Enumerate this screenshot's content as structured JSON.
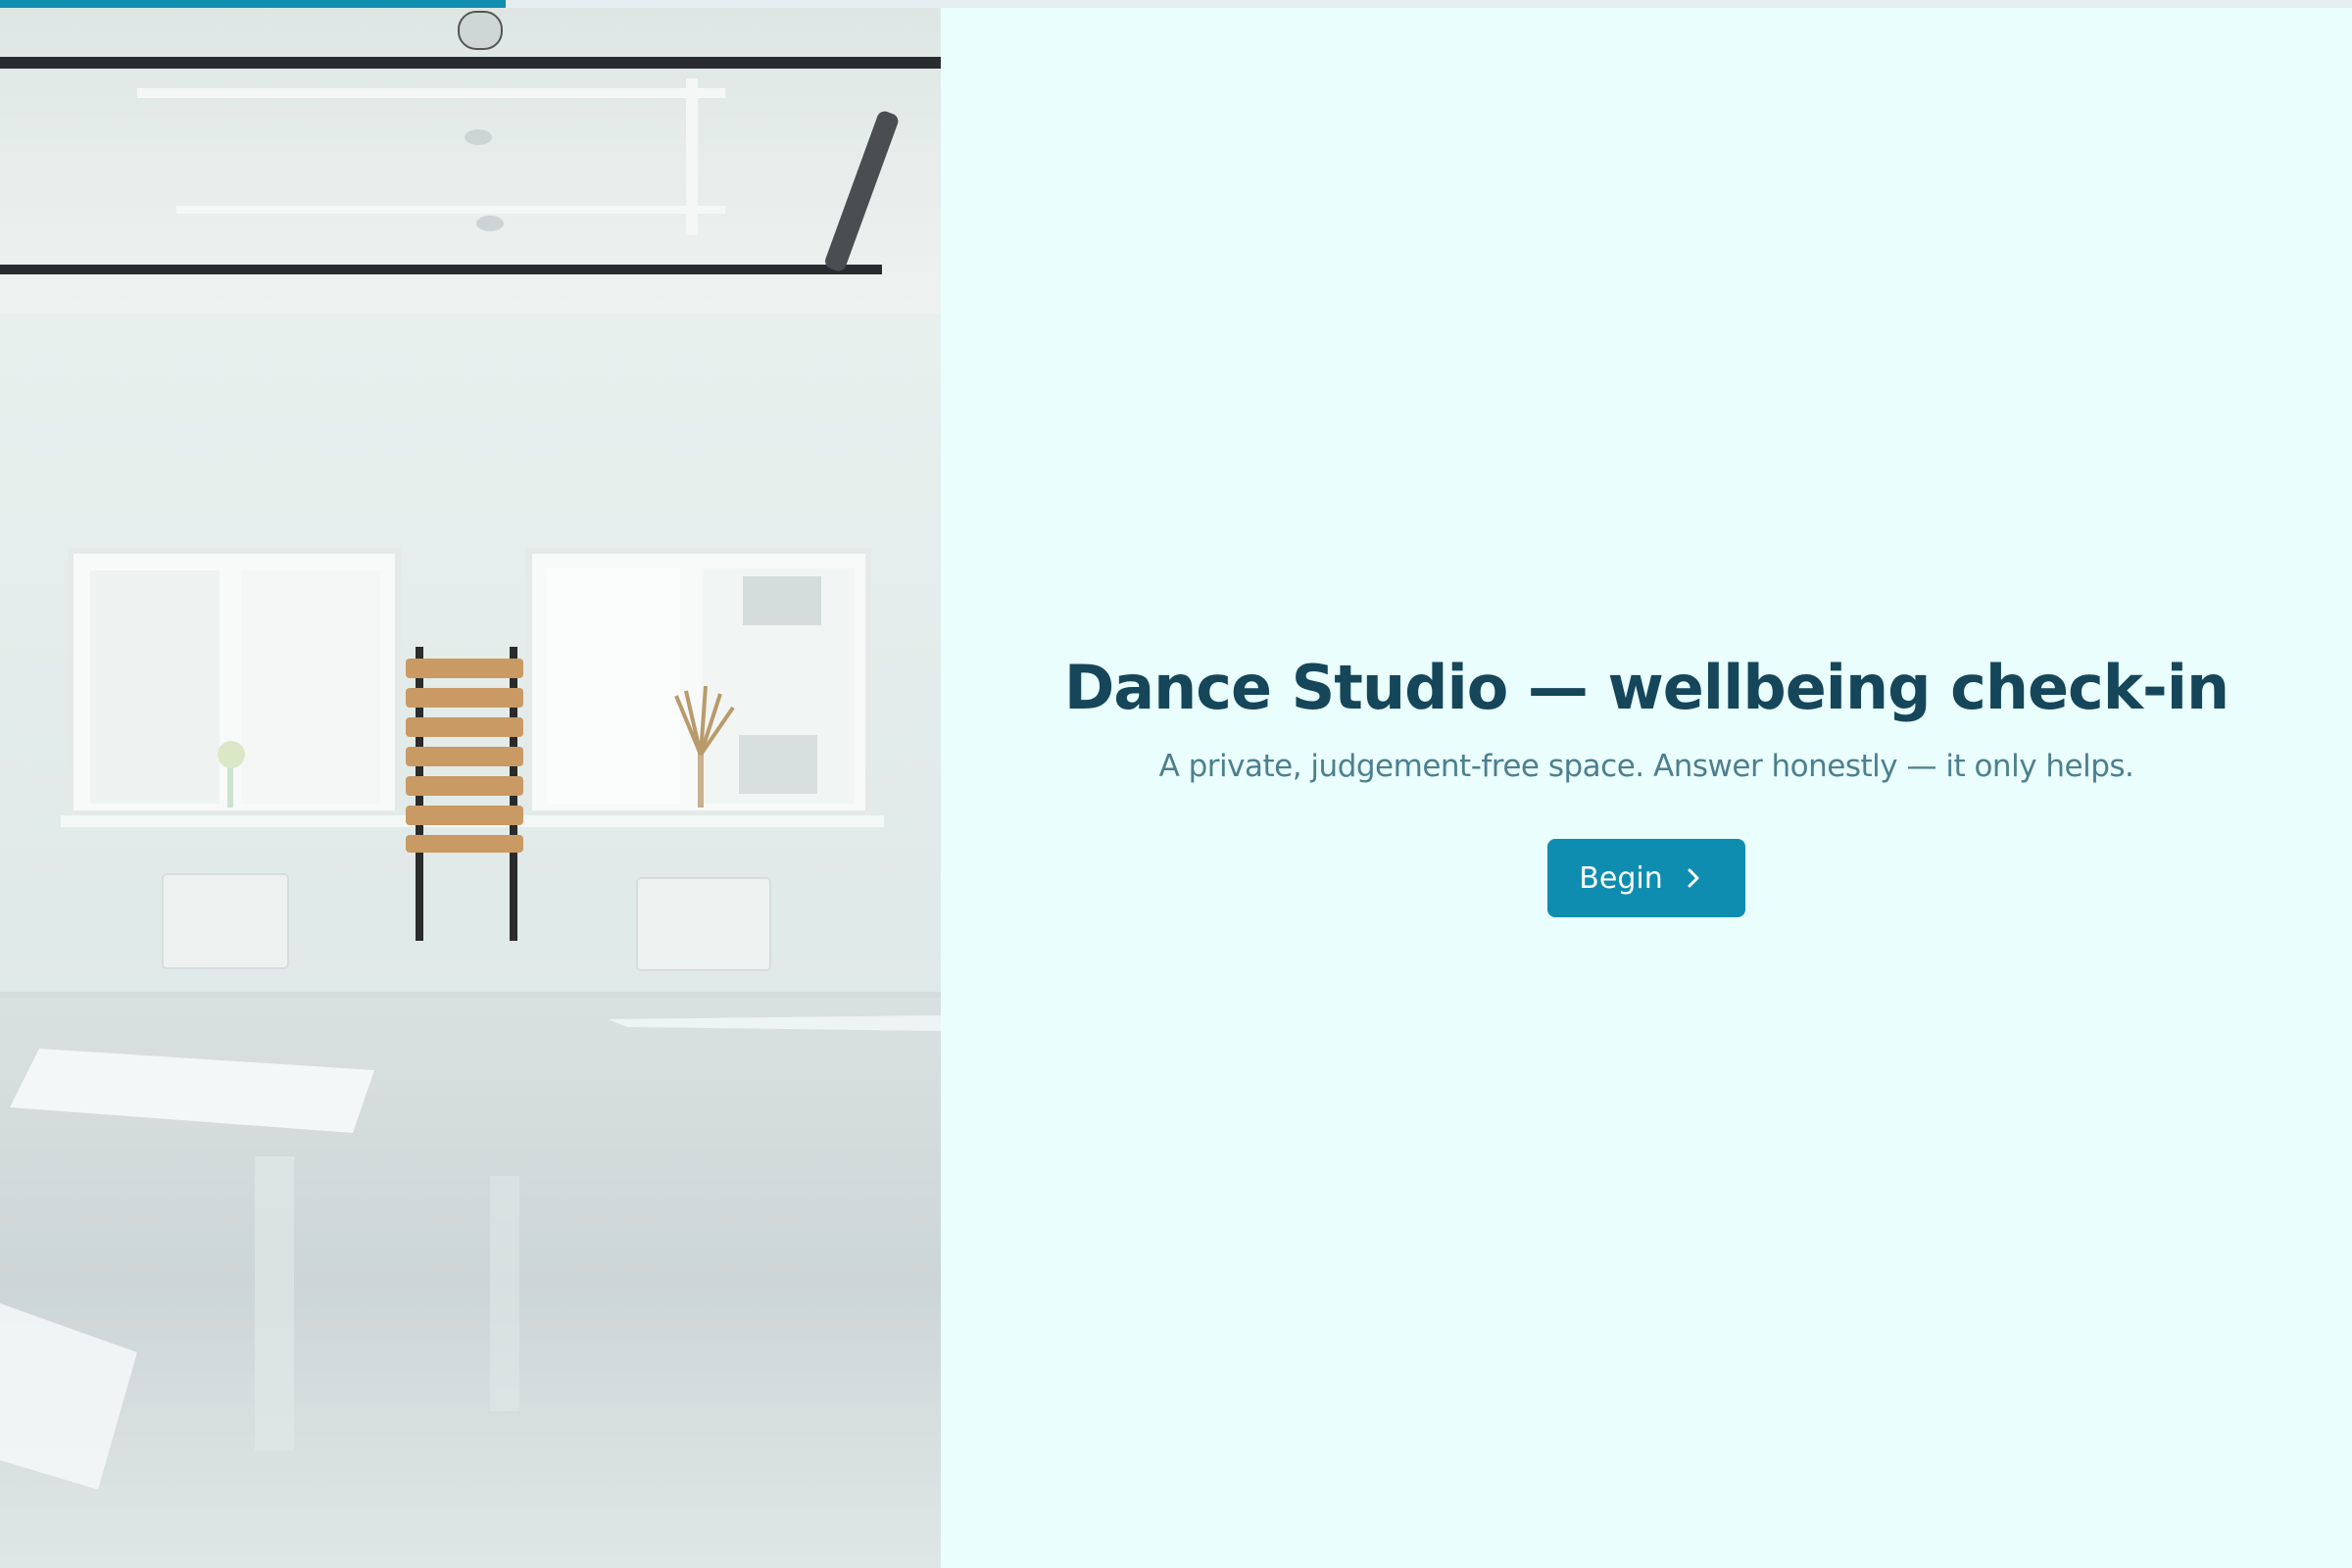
{
  "progress": {
    "fraction": 0.215,
    "color": "#128fb0"
  },
  "hero": {
    "title": "Dance Studio — wellbeing check-in",
    "subtitle": "A private, judgement-free space. Answer honestly — it only helps."
  },
  "actions": {
    "begin_label": "Begin",
    "begin_icon": "chevron-right-icon"
  },
  "colors": {
    "background": "#e9fefd",
    "title": "#15465a",
    "subtitle": "#4d7f8e",
    "accent": "#0f8db0"
  }
}
